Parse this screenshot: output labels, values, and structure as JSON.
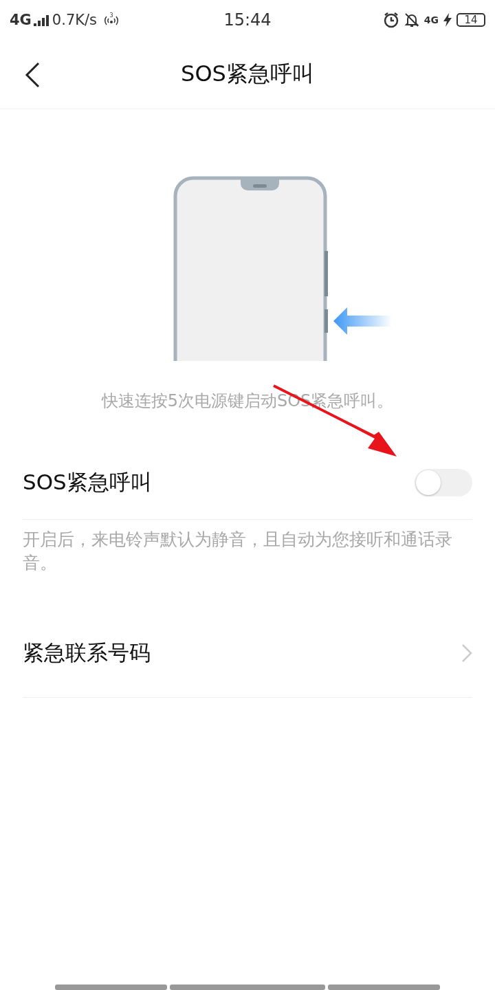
{
  "status_bar": {
    "network": "4G",
    "speed": "0.7K/s",
    "hotspot_count": "3",
    "time": "15:44",
    "network_right": "4G",
    "battery": "14"
  },
  "header": {
    "title": "SOS紧急呼叫"
  },
  "illustration": {
    "caption": "快速连按5次电源键启动SOS紧急呼叫。"
  },
  "settings": [
    {
      "kind": "toggle",
      "label": "SOS紧急呼叫",
      "on": false
    },
    {
      "kind": "note",
      "text": "开启后，来电铃声默认为静音，且自动为您接听和通话录音。"
    },
    {
      "kind": "link",
      "label": "紧急联系号码"
    }
  ],
  "annotation": {
    "kind": "arrow"
  }
}
